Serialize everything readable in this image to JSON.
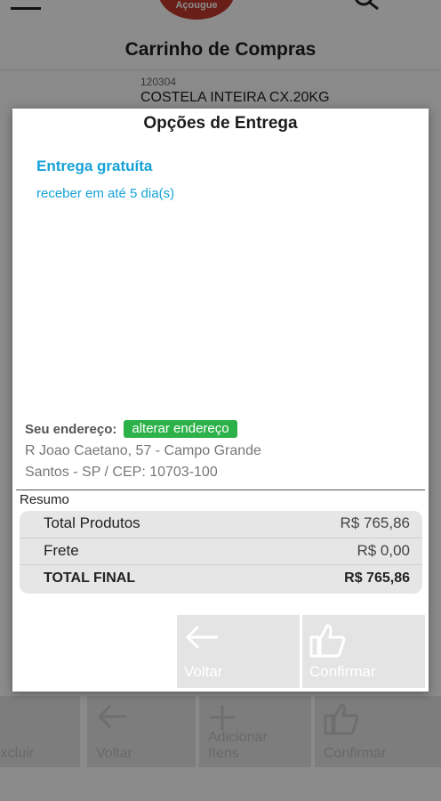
{
  "header": {
    "logo_text": "Açougue",
    "title": "Carrinho de Compras"
  },
  "cart_item": {
    "code": "120304",
    "name": "COSTELA INTEIRA CX.20KG"
  },
  "bg_footer": {
    "excluir": "Excluir",
    "voltar": "Voltar",
    "adicionar": "Adicionar Itens",
    "confirmar": "Confirmar"
  },
  "dialog": {
    "title": "Opções de Entrega",
    "option": {
      "title": "Entrega gratuíta",
      "description": "receber em até 5 dia(s)"
    },
    "address": {
      "label": "Seu endereço:",
      "change_button": "alterar endereço",
      "line1": "R Joao Caetano, 57 - Campo Grande",
      "line2": "Santos - SP / CEP: 10703-100"
    },
    "summary": {
      "label": "Resumo",
      "rows": [
        {
          "label": "Total Produtos",
          "value": "R$ 765,86"
        },
        {
          "label": "Frete",
          "value": "R$ 0,00"
        },
        {
          "label": "TOTAL FINAL",
          "value": "R$ 765,86"
        }
      ]
    },
    "buttons": {
      "back": "Voltar",
      "confirm": "Confirmar"
    }
  },
  "colors": {
    "accent_blue": "#16a2d7",
    "green_button": "#2db24a",
    "logo_red": "#c0392b"
  }
}
